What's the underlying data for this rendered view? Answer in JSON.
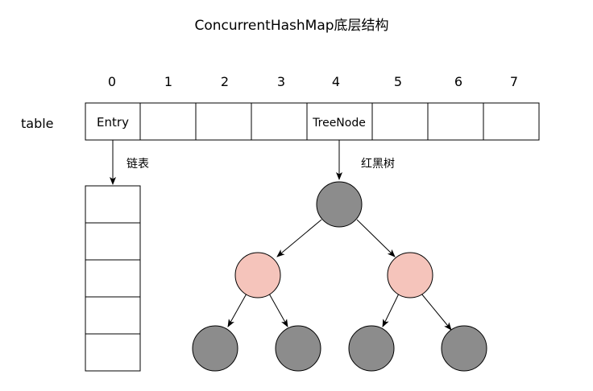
{
  "title": "ConcurrentHashMap底层结构",
  "table": {
    "label": "table",
    "indices": [
      "0",
      "1",
      "2",
      "3",
      "4",
      "5",
      "6",
      "7"
    ],
    "cells": [
      "Entry",
      "",
      "",
      "",
      "TreeNode",
      "",
      "",
      ""
    ]
  },
  "linked_list": {
    "label": "链表",
    "node_count": 5
  },
  "tree": {
    "label": "红黑树",
    "colors": {
      "black": "#8c8c8c",
      "red": "#f5c4bb",
      "stroke": "#000000"
    },
    "nodes": [
      {
        "id": "root",
        "color": "black"
      },
      {
        "id": "left",
        "color": "red"
      },
      {
        "id": "right",
        "color": "red"
      },
      {
        "id": "left-left",
        "color": "black"
      },
      {
        "id": "left-right",
        "color": "black"
      },
      {
        "id": "right-left",
        "color": "black"
      },
      {
        "id": "right-right",
        "color": "black"
      }
    ],
    "edges": [
      [
        "root",
        "left"
      ],
      [
        "root",
        "right"
      ],
      [
        "left",
        "left-left"
      ],
      [
        "left",
        "left-right"
      ],
      [
        "right",
        "right-left"
      ],
      [
        "right",
        "right-right"
      ]
    ]
  }
}
